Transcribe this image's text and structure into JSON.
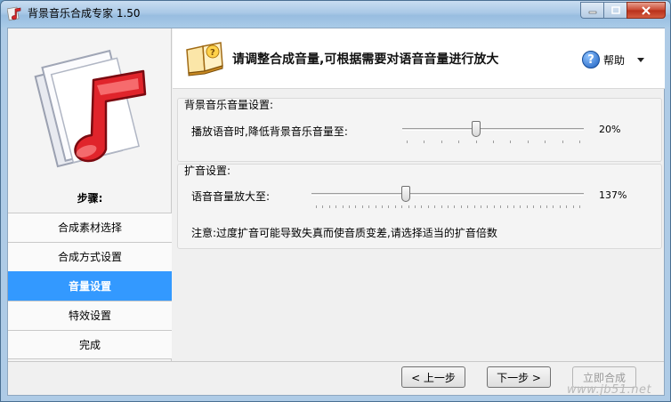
{
  "window": {
    "title": "背景音乐合成专家 1.50"
  },
  "sidebar": {
    "steps_label": "步骤:",
    "steps": [
      {
        "label": "合成素材选择",
        "active": false
      },
      {
        "label": "合成方式设置",
        "active": false
      },
      {
        "label": "音量设置",
        "active": true
      },
      {
        "label": "特效设置",
        "active": false
      },
      {
        "label": "完成",
        "active": false
      }
    ]
  },
  "header": {
    "title": "请调整合成音量,可根据需要对语音音量进行放大",
    "help_label": "帮助",
    "help_icon_glyph": "?"
  },
  "bg_music": {
    "group_title": "背景音乐音量设置:",
    "label": "播放语音时,降低背景音乐音量至:",
    "value": 20,
    "value_text": "20%"
  },
  "amplify": {
    "group_title": "扩音设置:",
    "label": "语音音量放大至:",
    "value": 137,
    "value_text": "137%",
    "note": "注意:过度扩音可能导致失真而使音质变差,请选择适当的扩音倍数"
  },
  "buttons": {
    "prev": "< 上一步",
    "next": "下一步 >",
    "start": "立即合成"
  },
  "watermark": "www.jb51.net",
  "colors": {
    "active_step": "#3399ff"
  }
}
